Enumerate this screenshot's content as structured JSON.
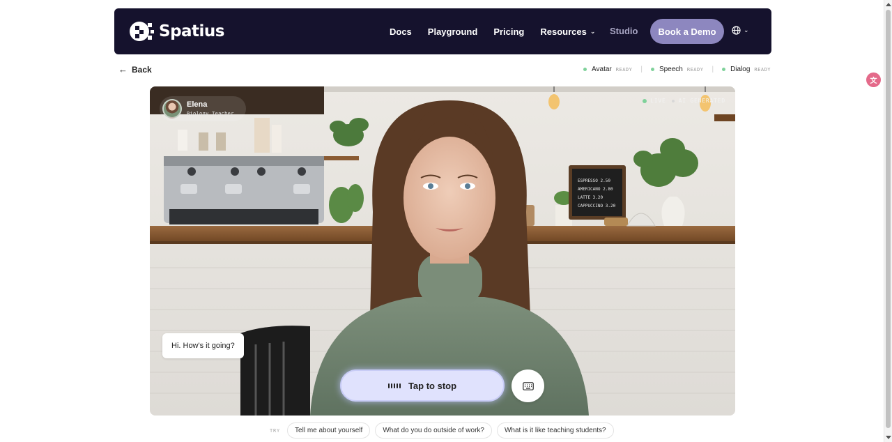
{
  "brand": {
    "name": "Spatius"
  },
  "nav": {
    "links": [
      {
        "label": "Docs"
      },
      {
        "label": "Playground"
      },
      {
        "label": "Pricing"
      },
      {
        "label": "Resources"
      }
    ],
    "studio_label": "Studio",
    "demo_label": "Book a Demo",
    "language_icon": "globe-icon"
  },
  "back_label": "Back",
  "statuses": [
    {
      "label": "Avatar",
      "state": "READY"
    },
    {
      "label": "Speech",
      "state": "READY"
    },
    {
      "label": "Dialog",
      "state": "READY"
    }
  ],
  "avatar": {
    "name": "Elena",
    "role": "Biology Teacher"
  },
  "badges": {
    "live": "LIVE",
    "ai": "AI GENERATED"
  },
  "bubble_text": "Hi. How's it going?",
  "controls": {
    "stop_label": "Tap to stop",
    "keyboard_icon": "keyboard-icon"
  },
  "suggestions": {
    "try_label": "TRY",
    "items": [
      "Tell me about yourself",
      "What do you do outside of work?",
      "What is it like teaching students?"
    ]
  },
  "chalkboard": [
    "ESPRESSO 2.50",
    "AMERICANO 2.80",
    "LATTE 3.20",
    "CAPPUCCINO 3.20"
  ],
  "colors": {
    "nav_bg": "#15122d",
    "demo_btn": "#8d87bf",
    "ready_dot": "#7fd19a",
    "stop_btn": "#e0e2fd"
  }
}
